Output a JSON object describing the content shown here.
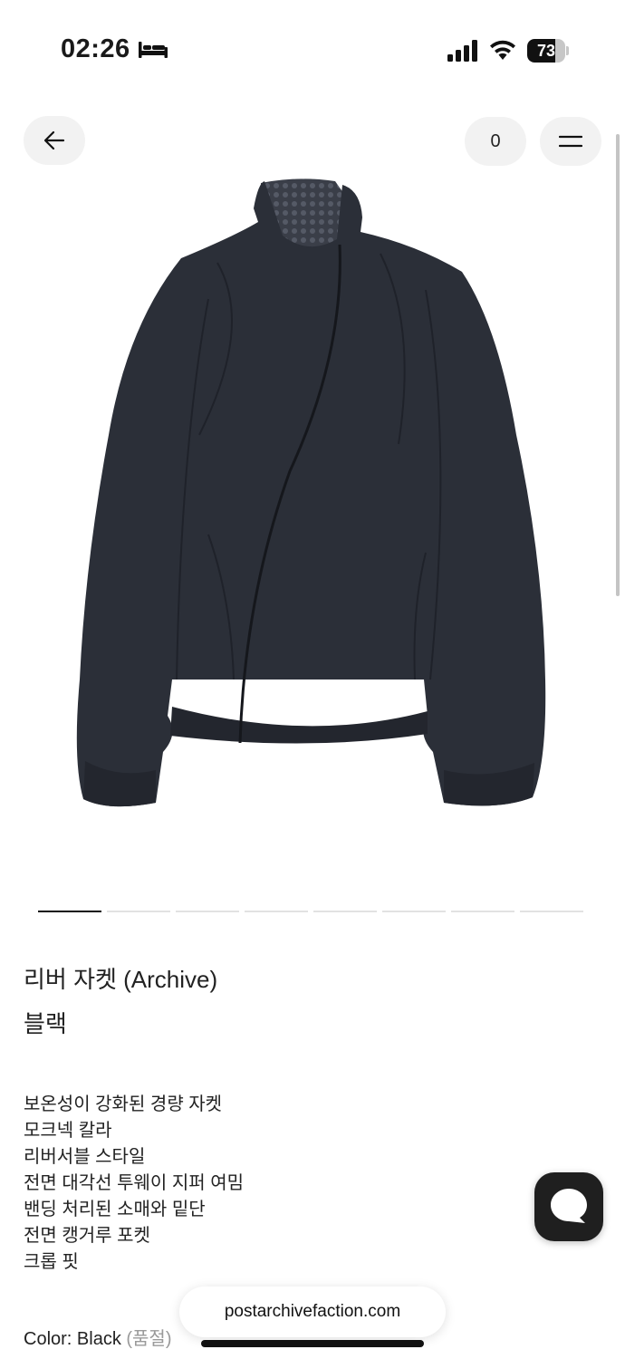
{
  "status_bar": {
    "time": "02:26",
    "battery_level": "73",
    "battery_fraction": 0.73,
    "icons": [
      "bed-icon",
      "signal-icon",
      "wifi-icon",
      "battery-icon"
    ]
  },
  "header": {
    "back_icon": "arrow-left-icon",
    "cart_count": "0",
    "menu_icon": "hamburger-menu-icon"
  },
  "product": {
    "image_alt_icon": "jacket-image",
    "carousel": {
      "total": 8,
      "active_index": 0
    },
    "name": "리버 자켓 (Archive)",
    "color_name": "블랙",
    "description": [
      "보온성이 강화된 경량 자켓",
      "모크넥 칼라",
      "리버서블 스타일",
      "전면 대각선 투웨이 지퍼 여밈",
      "밴딩 처리된 소매와 밑단",
      "전면 캥거루 포켓",
      "크롭 핏"
    ],
    "color_label": "Color: Black",
    "color_status": "(품절)"
  },
  "chat": {
    "icon": "chat-bubble-icon"
  },
  "browser": {
    "url": "postarchivefaction.com"
  },
  "colors": {
    "jacket": "#2b2f38",
    "accent": "#111111",
    "muted": "#9a9a9a"
  }
}
